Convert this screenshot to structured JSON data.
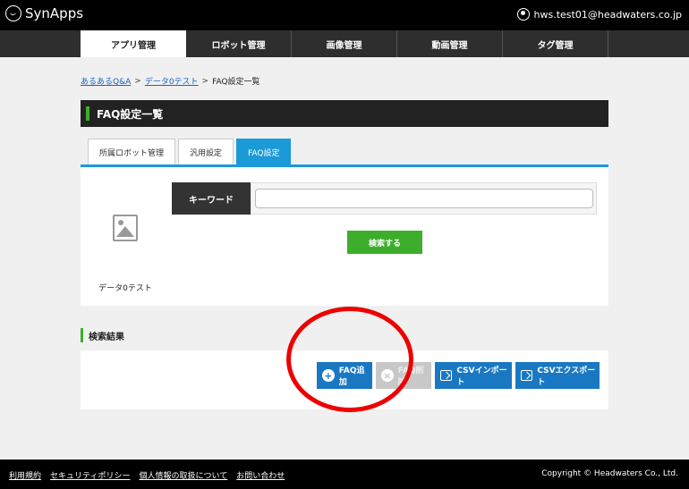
{
  "header": {
    "brand": "SynApps",
    "user_email": "hws.test01@headwaters.co.jp"
  },
  "nav": {
    "items": [
      {
        "label": "アプリ管理"
      },
      {
        "label": "ロボット管理"
      },
      {
        "label": "画像管理"
      },
      {
        "label": "動画管理"
      },
      {
        "label": "タグ管理"
      }
    ],
    "active_index": 0
  },
  "breadcrumb": [
    {
      "label": "あるあるQ&A",
      "link": true
    },
    {
      "label": "データ0テスト",
      "link": true
    },
    {
      "label": "FAQ設定一覧",
      "link": false
    }
  ],
  "page_title": "FAQ設定一覧",
  "tabs": [
    {
      "label": "所属ロボット管理"
    },
    {
      "label": "汎用設定"
    },
    {
      "label": "FAQ設定"
    }
  ],
  "active_tab": 2,
  "search": {
    "robot_name": "データ0テスト",
    "keyword_label": "キーワード",
    "keyword_value": "",
    "button_label": "検索する"
  },
  "results": {
    "title": "検索結果",
    "buttons": {
      "add": "FAQ追加",
      "delete": "FAQ削除",
      "csv_import": "CSVインポート",
      "csv_export": "CSVエクスポート"
    }
  },
  "annotation": {
    "color": "#e00000"
  },
  "footer": {
    "links": [
      "利用規約",
      "セキュリティポリシー",
      "個人情報の取扱について",
      "お問い合わせ"
    ],
    "copyright": "Copyright © Headwaters Co., Ltd."
  },
  "colors": {
    "accent_green": "#3dae2b",
    "accent_blue": "#1a9bd7",
    "button_blue": "#1a78c2"
  }
}
